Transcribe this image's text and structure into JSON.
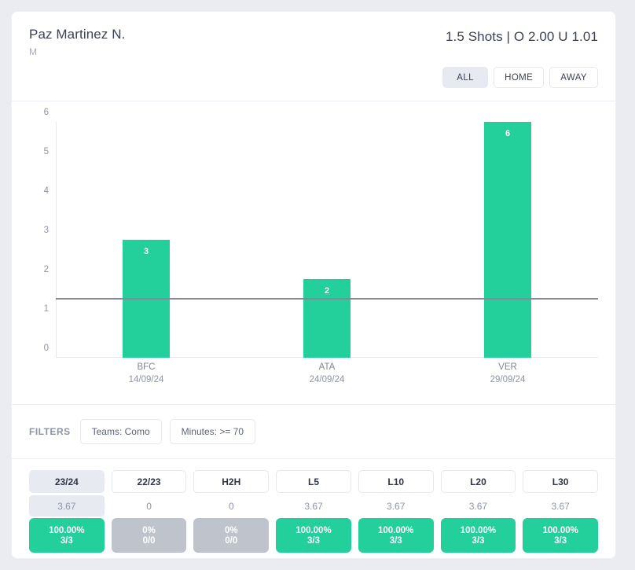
{
  "header": {
    "player_name": "Paz Martinez N.",
    "player_position": "M",
    "odds_line": "1.5 Shots | O 2.00 U 1.01",
    "venue_tabs": [
      {
        "label": "ALL",
        "selected": true
      },
      {
        "label": "HOME",
        "selected": false
      },
      {
        "label": "AWAY",
        "selected": false
      }
    ]
  },
  "chart_data": {
    "type": "bar",
    "title": "",
    "xlabel": "",
    "ylabel": "",
    "ylim": [
      0,
      6
    ],
    "yticks": [
      0,
      1,
      2,
      3,
      4,
      5,
      6
    ],
    "grid": false,
    "legend": "none",
    "threshold": 1.5,
    "threshold_label": "1.5",
    "bar_color": "#23cf9b",
    "categories": [
      "BFC",
      "ATA",
      "VER"
    ],
    "dates": [
      "14/09/24",
      "24/09/24",
      "29/09/24"
    ],
    "values": [
      3,
      2,
      6
    ]
  },
  "filters": {
    "label": "FILTERS",
    "chips": [
      {
        "label": "Teams: Como"
      },
      {
        "label": "Minutes: >= 70"
      }
    ]
  },
  "stats": {
    "columns": [
      {
        "header": "23/24",
        "average": "3.67",
        "percent": "100.00%",
        "ratio": "3/3",
        "state": "hit",
        "selected": true
      },
      {
        "header": "22/23",
        "average": "0",
        "percent": "0%",
        "ratio": "0/0",
        "state": "miss",
        "selected": false
      },
      {
        "header": "H2H",
        "average": "0",
        "percent": "0%",
        "ratio": "0/0",
        "state": "miss",
        "selected": false
      },
      {
        "header": "L5",
        "average": "3.67",
        "percent": "100.00%",
        "ratio": "3/3",
        "state": "hit",
        "selected": false
      },
      {
        "header": "L10",
        "average": "3.67",
        "percent": "100.00%",
        "ratio": "3/3",
        "state": "hit",
        "selected": false
      },
      {
        "header": "L20",
        "average": "3.67",
        "percent": "100.00%",
        "ratio": "3/3",
        "state": "hit",
        "selected": false
      },
      {
        "header": "L30",
        "average": "3.67",
        "percent": "100.00%",
        "ratio": "3/3",
        "state": "hit",
        "selected": false
      }
    ]
  },
  "colors": {
    "accent_green": "#23cf9b",
    "muted_grey": "#bfc3cc",
    "selected_bg": "#e8eaf1",
    "page_bg": "#eaecf2"
  }
}
